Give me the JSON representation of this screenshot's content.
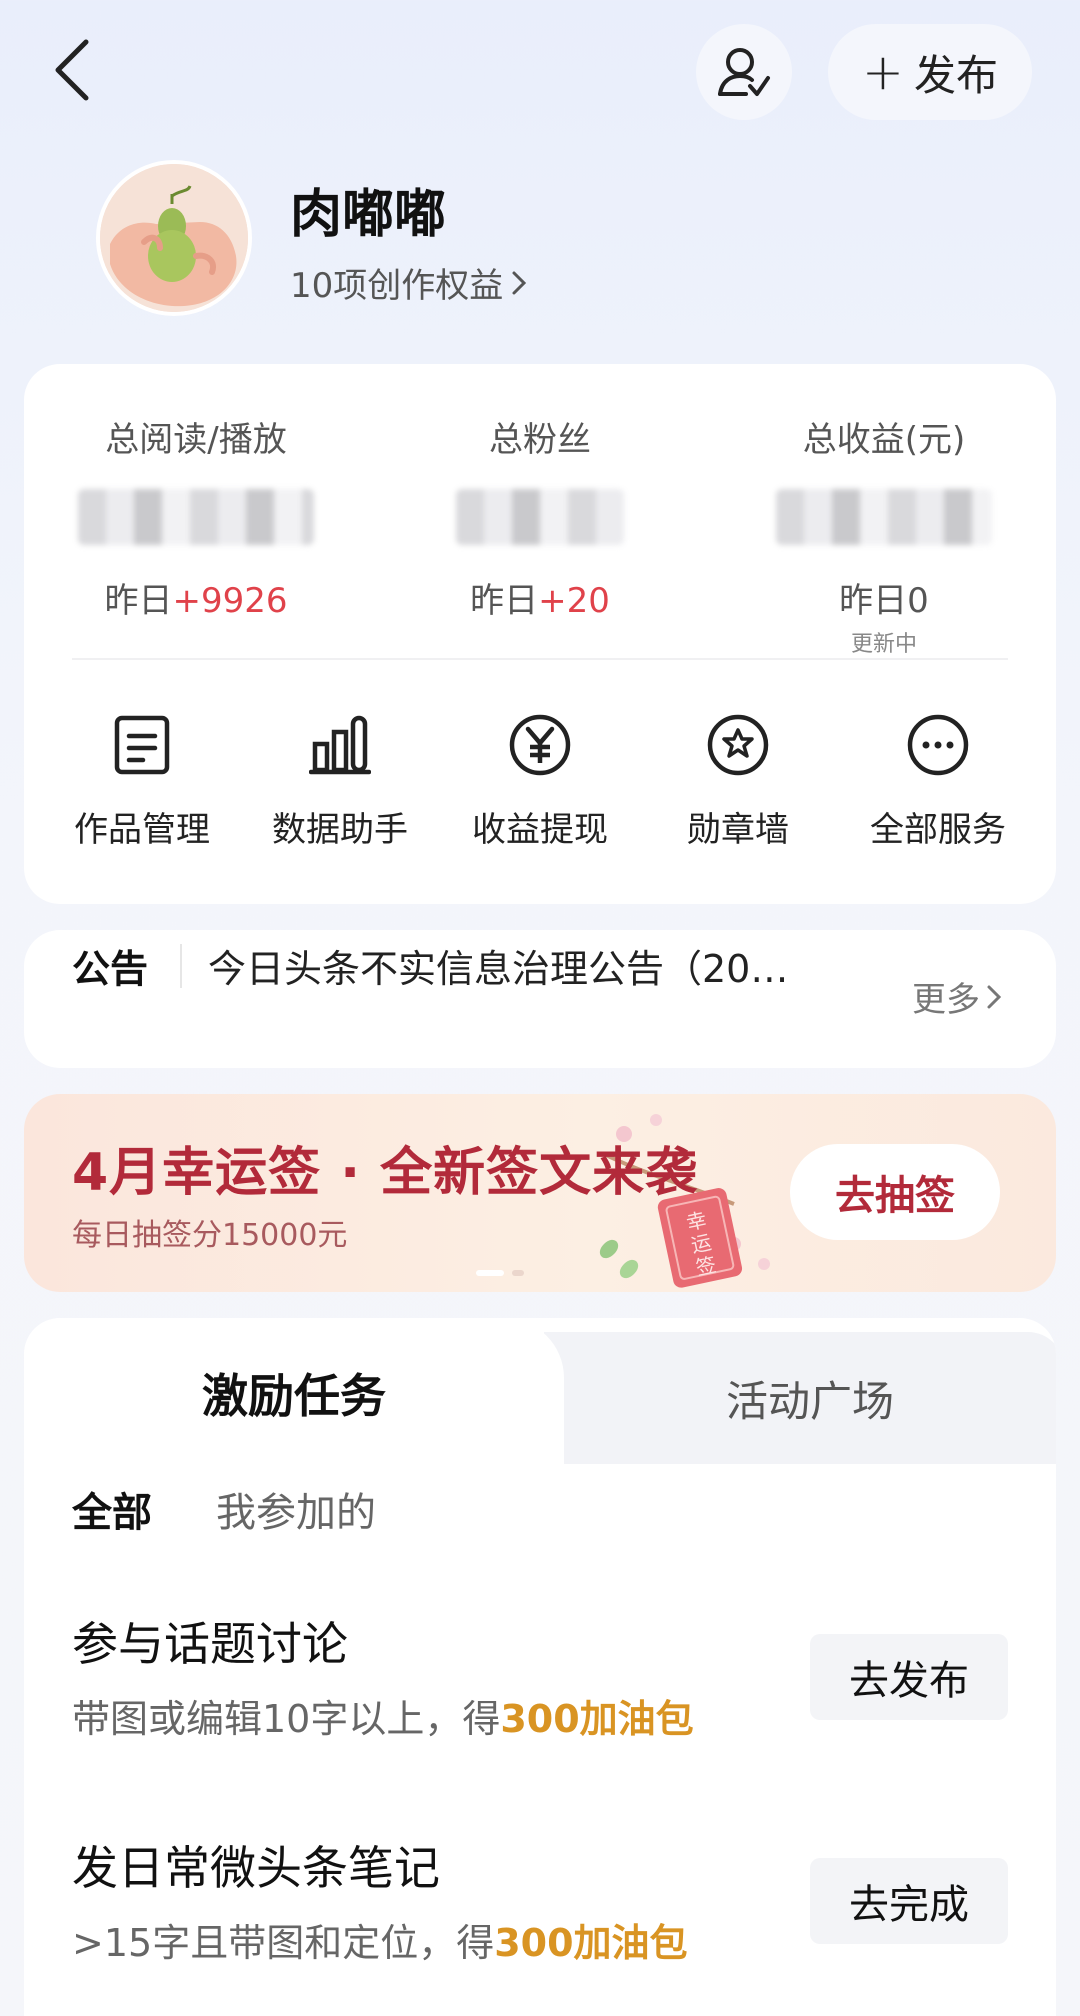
{
  "header": {
    "publish_label": "发布",
    "publish_icon": "plus-icon",
    "back_icon": "back-chevron-icon",
    "follow_icon": "user-follow-icon"
  },
  "profile": {
    "username": "肉嘟嘟",
    "benefits": "10项创作权益"
  },
  "stats": [
    {
      "label": "总阅读/播放",
      "yesterday_prefix": "昨日",
      "yesterday_value": "+9926",
      "sub": ""
    },
    {
      "label": "总粉丝",
      "yesterday_prefix": "昨日",
      "yesterday_value": "+20",
      "sub": ""
    },
    {
      "label": "总收益(元)",
      "yesterday_prefix": "昨日",
      "yesterday_value": "0",
      "sub": "更新中"
    }
  ],
  "services": [
    {
      "label": "作品管理",
      "icon": "document-icon"
    },
    {
      "label": "数据助手",
      "icon": "bar-chart-icon"
    },
    {
      "label": "收益提现",
      "icon": "yen-circle-icon"
    },
    {
      "label": "勋章墙",
      "icon": "medal-icon"
    },
    {
      "label": "全部服务",
      "icon": "more-dots-icon"
    }
  ],
  "notice": {
    "tag": "公告",
    "text": "今日头条不实信息治理公告（20…",
    "more": "更多"
  },
  "banner": {
    "title": "4月幸运签 · 全新签文来袭",
    "subtitle": "每日抽签分15000元",
    "button": "去抽签",
    "charm_text": "幸运签"
  },
  "tabs": {
    "active": "激励任务",
    "other": "活动广场"
  },
  "filters": {
    "all": "全部",
    "mine": "我参加的"
  },
  "tasks": [
    {
      "title": "参与话题讨论",
      "desc_prefix": "带图或编辑10字以上，得",
      "reward": "300加油包",
      "button": "去发布"
    },
    {
      "title": "发日常微头条笔记",
      "desc_prefix": ">15字且带图和定位，得",
      "reward": "300加油包",
      "button": "去完成"
    }
  ],
  "colors": {
    "increase": "#e0424a",
    "reward": "#d99423",
    "banner_accent": "#b22a3a"
  }
}
